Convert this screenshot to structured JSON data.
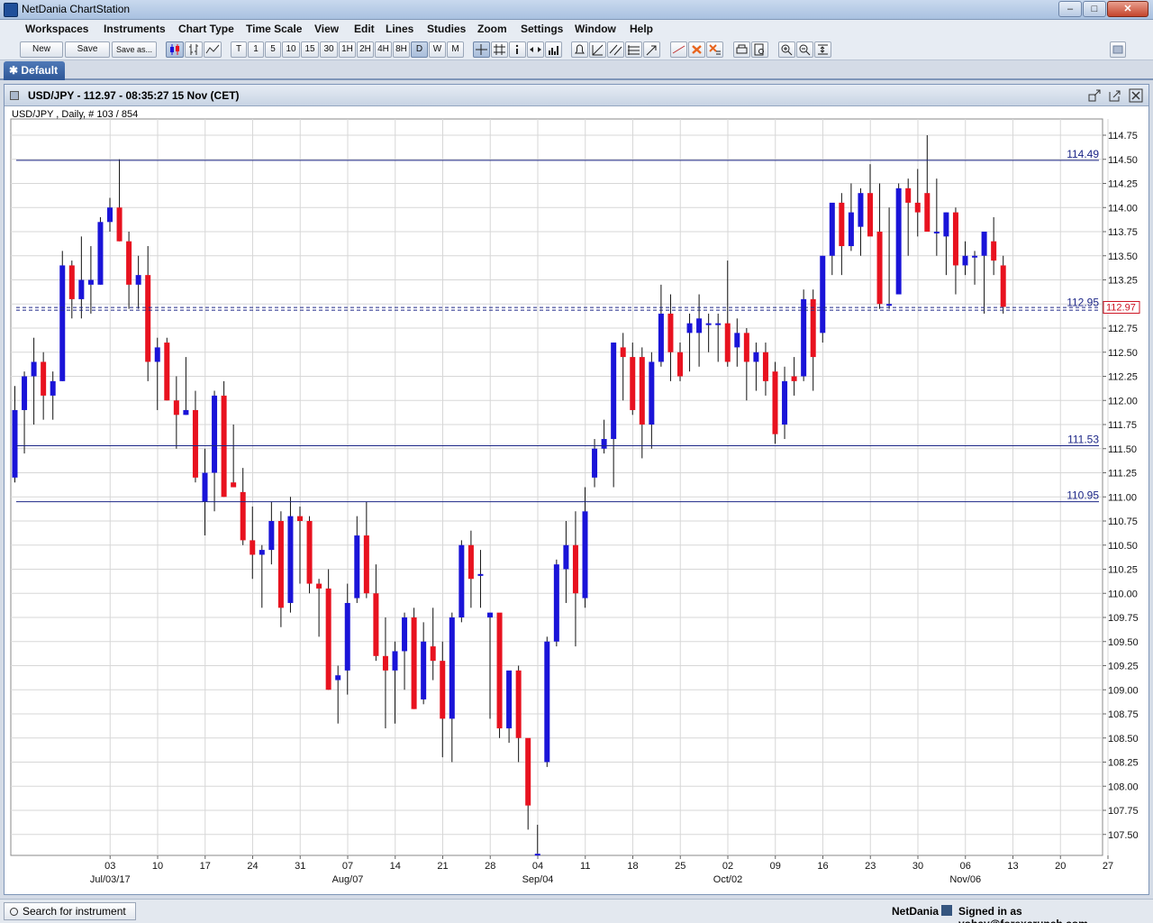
{
  "window": {
    "title": "NetDania ChartStation",
    "minimize": "‒",
    "maximize": "□",
    "close": "✕"
  },
  "menu": [
    "Workspaces",
    "Instruments",
    "Chart Type",
    "Time Scale",
    "View",
    "Edit",
    "Lines",
    "Studies",
    "Zoom",
    "Settings",
    "Window",
    "Help"
  ],
  "toolbar": {
    "new_label": "New",
    "save_label": "Save",
    "saveas_label": "Save as...",
    "timescale": [
      "T",
      "1",
      "5",
      "10",
      "15",
      "30",
      "1H",
      "2H",
      "4H",
      "8H",
      "D",
      "W",
      "M"
    ],
    "selected_timescale": "D"
  },
  "tab": {
    "label": "✱ Default"
  },
  "chart_window": {
    "title": "USD/JPY - 112.97 - 08:35:27  15 Nov (CET)",
    "info": "USD/JPY , Daily, # 103 / 854",
    "current_price_label": "112.97"
  },
  "status": {
    "search_label": "Search for instrument",
    "brand": "NetDania",
    "signed_in": "Signed in as yohay@forexcrunch.com"
  },
  "colors": {
    "up": "#1a14d8",
    "down": "#e8121f",
    "line": "#1c2687"
  },
  "chart_data": {
    "type": "candlestick",
    "instrument": "USD/JPY",
    "timeframe": "Daily",
    "y_range": [
      107.25,
      114.95
    ],
    "y_ticks": [
      "114.75",
      "114.50",
      "114.25",
      "114.00",
      "113.75",
      "113.50",
      "113.25",
      "113.00",
      "112.75",
      "112.50",
      "112.25",
      "112.00",
      "111.75",
      "111.50",
      "111.25",
      "111.00",
      "110.75",
      "110.50",
      "110.25",
      "110.00",
      "109.75",
      "109.50",
      "109.25",
      "109.00",
      "108.75",
      "108.50",
      "108.25",
      "108.00",
      "107.75",
      "107.50"
    ],
    "x_ticks": [
      {
        "label": "03",
        "sub": "Jul/03/17",
        "i": 5
      },
      {
        "label": "10",
        "i": 10
      },
      {
        "label": "17",
        "i": 15
      },
      {
        "label": "24",
        "i": 20
      },
      {
        "label": "31",
        "i": 25
      },
      {
        "label": "07",
        "sub": "Aug/07",
        "i": 30
      },
      {
        "label": "14",
        "i": 35
      },
      {
        "label": "21",
        "i": 40
      },
      {
        "label": "28",
        "i": 45
      },
      {
        "label": "04",
        "sub": "Sep/04",
        "i": 50
      },
      {
        "label": "11",
        "i": 55
      },
      {
        "label": "18",
        "i": 60
      },
      {
        "label": "25",
        "i": 65
      },
      {
        "label": "02",
        "sub": "Oct/02",
        "i": 70
      },
      {
        "label": "09",
        "i": 75
      },
      {
        "label": "16",
        "i": 80
      },
      {
        "label": "23",
        "i": 85
      },
      {
        "label": "30",
        "i": 90
      },
      {
        "label": "06",
        "sub": "Nov/06",
        "i": 95
      },
      {
        "label": "13",
        "i": 100
      },
      {
        "label": "20",
        "i": 105
      },
      {
        "label": "27",
        "i": 110
      }
    ],
    "horizontal_lines": [
      {
        "value": 114.49,
        "label": "114.49",
        "dashed": false
      },
      {
        "value": 112.95,
        "label": "112.95",
        "dashed": true
      },
      {
        "value": 111.53,
        "label": "111.53",
        "dashed": false
      },
      {
        "value": 110.95,
        "label": "110.95",
        "dashed": false
      }
    ],
    "current_price": 112.97,
    "ohlc": [
      [
        111.2,
        112.15,
        111.15,
        111.9
      ],
      [
        111.9,
        112.3,
        111.45,
        112.25
      ],
      [
        112.25,
        112.65,
        111.75,
        112.4
      ],
      [
        112.4,
        112.5,
        111.8,
        112.05
      ],
      [
        112.05,
        112.3,
        111.8,
        112.2
      ],
      [
        112.2,
        113.55,
        112.2,
        113.4
      ],
      [
        113.4,
        113.45,
        112.85,
        113.05
      ],
      [
        113.05,
        113.7,
        112.85,
        113.25
      ],
      [
        113.2,
        113.6,
        112.9,
        113.25
      ],
      [
        113.2,
        113.9,
        113.2,
        113.85
      ],
      [
        113.85,
        114.1,
        113.75,
        114.0
      ],
      [
        114.0,
        114.5,
        113.65,
        113.65
      ],
      [
        113.65,
        113.75,
        112.95,
        113.2
      ],
      [
        113.2,
        113.5,
        112.95,
        113.3
      ],
      [
        113.3,
        113.6,
        112.2,
        112.4
      ],
      [
        112.4,
        112.65,
        111.9,
        112.55
      ],
      [
        112.6,
        112.65,
        112.0,
        112.0
      ],
      [
        112.0,
        112.25,
        111.5,
        111.85
      ],
      [
        111.85,
        112.45,
        111.85,
        111.9
      ],
      [
        111.9,
        112.1,
        111.15,
        111.2
      ],
      [
        110.95,
        111.5,
        110.6,
        111.25
      ],
      [
        111.25,
        112.1,
        110.85,
        112.05
      ],
      [
        112.05,
        112.2,
        111.0,
        111.0
      ],
      [
        111.15,
        111.75,
        111.1,
        111.1
      ],
      [
        111.05,
        111.3,
        110.5,
        110.55
      ],
      [
        110.55,
        110.9,
        110.15,
        110.4
      ],
      [
        110.4,
        110.5,
        109.85,
        110.45
      ],
      [
        110.45,
        110.95,
        110.3,
        110.75
      ],
      [
        110.75,
        110.85,
        109.65,
        109.85
      ],
      [
        109.9,
        111.0,
        109.8,
        110.8
      ],
      [
        110.8,
        110.9,
        110.1,
        110.75
      ],
      [
        110.75,
        110.8,
        110.0,
        110.1
      ],
      [
        110.1,
        110.15,
        109.55,
        110.05
      ],
      [
        110.05,
        110.25,
        109.0,
        109.0
      ],
      [
        109.1,
        109.25,
        108.65,
        109.15
      ],
      [
        109.2,
        110.1,
        108.95,
        109.9
      ],
      [
        109.95,
        110.8,
        109.9,
        110.6
      ],
      [
        110.6,
        110.95,
        109.95,
        110.0
      ],
      [
        110.0,
        110.3,
        109.3,
        109.35
      ],
      [
        109.35,
        109.75,
        108.6,
        109.2
      ],
      [
        109.2,
        109.5,
        108.65,
        109.4
      ],
      [
        109.4,
        109.8,
        109.0,
        109.75
      ],
      [
        109.75,
        109.85,
        108.8,
        108.8
      ],
      [
        108.9,
        109.7,
        108.85,
        109.5
      ],
      [
        109.45,
        109.85,
        109.1,
        109.3
      ],
      [
        109.3,
        109.5,
        108.3,
        108.7
      ],
      [
        108.7,
        109.8,
        108.25,
        109.75
      ],
      [
        109.75,
        110.55,
        109.7,
        110.5
      ],
      [
        110.5,
        110.65,
        109.85,
        110.15
      ],
      [
        110.2,
        110.45,
        109.85,
        110.2
      ],
      [
        109.75,
        109.8,
        108.7,
        109.8
      ],
      [
        109.8,
        109.6,
        108.5,
        108.6
      ],
      [
        108.6,
        109.15,
        108.45,
        109.2
      ],
      [
        109.2,
        109.25,
        108.25,
        108.5
      ],
      [
        108.5,
        108.45,
        107.55,
        107.8
      ],
      [
        107.3,
        107.6,
        107.3,
        107.3
      ],
      [
        108.25,
        109.55,
        108.2,
        109.5
      ],
      [
        109.5,
        110.35,
        109.45,
        110.3
      ],
      [
        110.25,
        110.75,
        109.9,
        110.5
      ],
      [
        110.5,
        110.85,
        109.45,
        110.0
      ],
      [
        109.95,
        111.1,
        109.85,
        110.85
      ],
      [
        111.2,
        111.6,
        111.1,
        111.5
      ],
      [
        111.5,
        111.8,
        111.45,
        111.6
      ],
      [
        111.6,
        112.6,
        111.1,
        112.6
      ],
      [
        112.55,
        112.7,
        112.0,
        112.45
      ],
      [
        112.45,
        112.6,
        111.85,
        111.9
      ],
      [
        112.45,
        112.55,
        111.4,
        111.75
      ],
      [
        111.75,
        112.5,
        111.5,
        112.4
      ],
      [
        112.4,
        113.2,
        112.35,
        112.9
      ],
      [
        112.9,
        113.1,
        112.2,
        112.5
      ],
      [
        112.5,
        112.6,
        112.2,
        112.25
      ],
      [
        112.7,
        112.9,
        112.3,
        112.8
      ],
      [
        112.7,
        113.1,
        112.35,
        112.85
      ],
      [
        112.8,
        112.9,
        112.5,
        112.8
      ],
      [
        112.8,
        112.9,
        112.4,
        112.8
      ],
      [
        112.8,
        113.45,
        112.35,
        112.4
      ],
      [
        112.55,
        112.85,
        112.35,
        112.7
      ],
      [
        112.7,
        112.75,
        112.0,
        112.4
      ],
      [
        112.4,
        112.6,
        112.1,
        112.5
      ],
      [
        112.5,
        112.6,
        112.05,
        112.2
      ],
      [
        112.3,
        112.4,
        111.55,
        111.65
      ],
      [
        111.75,
        112.35,
        111.6,
        112.2
      ],
      [
        112.25,
        112.45,
        112.05,
        112.2
      ],
      [
        112.25,
        113.15,
        112.2,
        113.05
      ],
      [
        113.05,
        113.15,
        112.1,
        112.45
      ],
      [
        112.7,
        113.5,
        112.6,
        113.5
      ],
      [
        113.5,
        113.95,
        113.3,
        114.05
      ],
      [
        114.05,
        114.15,
        113.3,
        113.6
      ],
      [
        113.6,
        114.25,
        113.55,
        113.95
      ],
      [
        113.8,
        114.2,
        113.5,
        114.15
      ],
      [
        114.15,
        114.45,
        113.9,
        113.7
      ],
      [
        113.75,
        114.25,
        112.95,
        113.0
      ],
      [
        113.0,
        114.0,
        112.95,
        113.0
      ],
      [
        113.1,
        114.25,
        113.6,
        114.2
      ],
      [
        114.2,
        114.3,
        113.5,
        114.05
      ],
      [
        114.05,
        114.4,
        113.7,
        113.95
      ],
      [
        114.15,
        114.75,
        113.8,
        113.75
      ],
      [
        113.75,
        114.3,
        113.5,
        113.75
      ],
      [
        113.7,
        113.95,
        113.3,
        113.95
      ],
      [
        113.95,
        114.0,
        113.1,
        113.4
      ],
      [
        113.4,
        113.65,
        113.3,
        113.5
      ],
      [
        113.5,
        113.55,
        113.2,
        113.5
      ],
      [
        113.5,
        113.65,
        112.9,
        113.75
      ],
      [
        113.65,
        113.9,
        113.3,
        113.45
      ],
      [
        113.4,
        113.5,
        112.9,
        112.97
      ]
    ]
  }
}
